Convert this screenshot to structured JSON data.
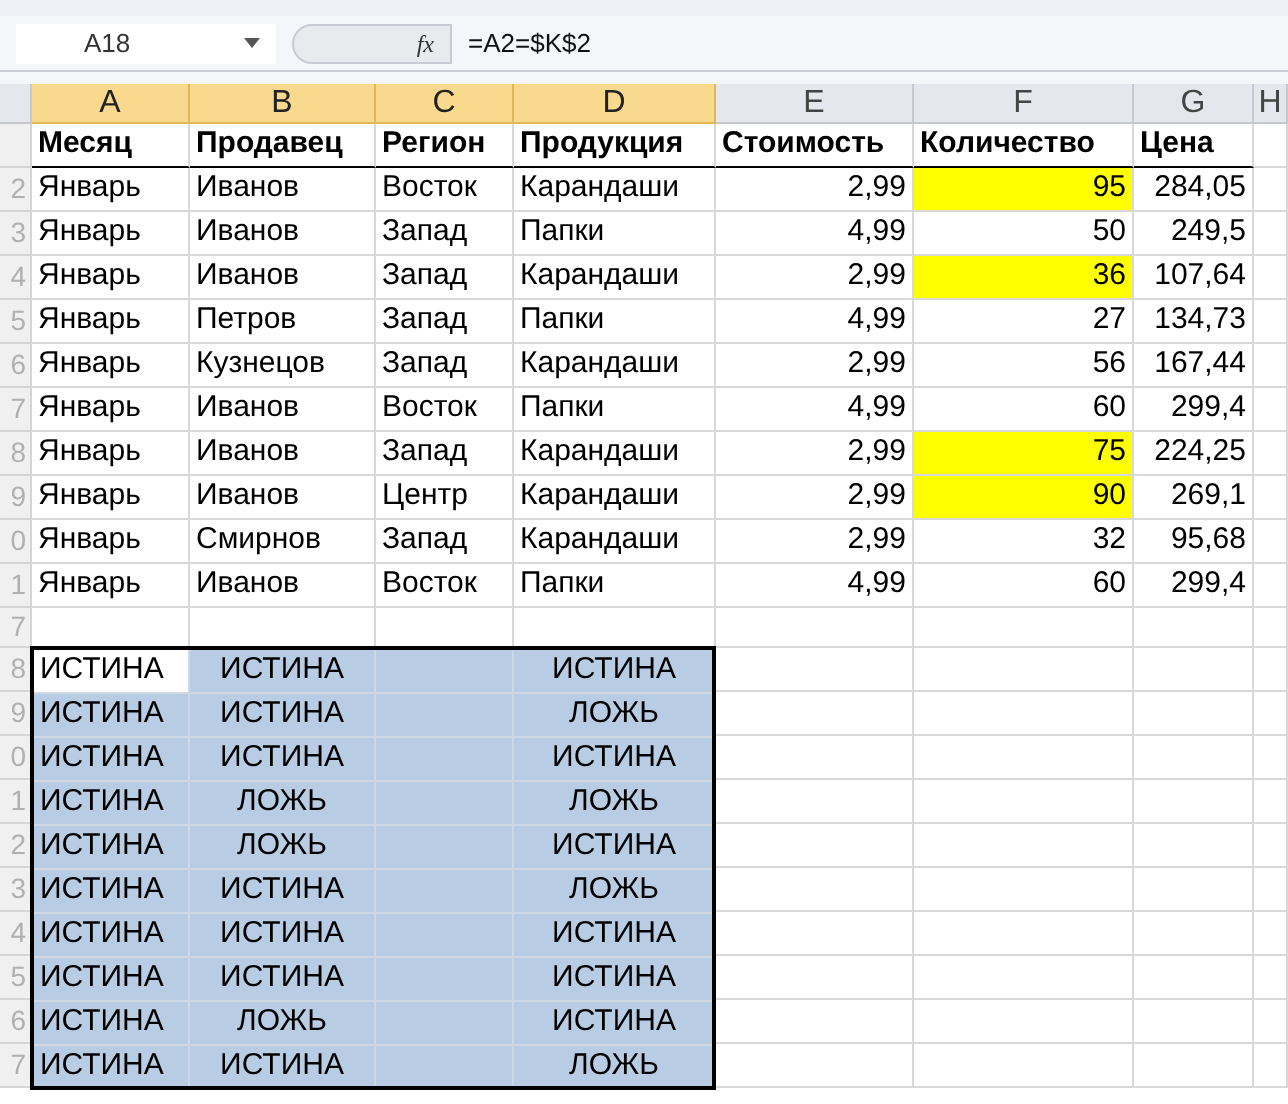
{
  "formula_bar": {
    "name_box": "A18",
    "fx": "fx",
    "formula": "=A2=$K$2"
  },
  "columns": [
    {
      "label": "A",
      "selected": true
    },
    {
      "label": "B",
      "selected": true
    },
    {
      "label": "C",
      "selected": true
    },
    {
      "label": "D",
      "selected": true
    },
    {
      "label": "E",
      "selected": false
    },
    {
      "label": "F",
      "selected": false
    },
    {
      "label": "G",
      "selected": false
    },
    {
      "label": "H",
      "selected": false
    }
  ],
  "header_row": {
    "cells": [
      "Месяц",
      "Продавец",
      "Регион",
      "Продукция",
      "Стоимость",
      "Количество",
      "Цена"
    ]
  },
  "rows": [
    {
      "row_number": "2",
      "cells": [
        "Январь",
        "Иванов",
        "Восток",
        "Карандаши",
        "2,99",
        "95",
        "284,05"
      ],
      "highlighted": true
    },
    {
      "row_number": "3",
      "cells": [
        "Январь",
        "Иванов",
        "Запад",
        "Папки",
        "4,99",
        "50",
        "249,5"
      ],
      "highlighted": false
    },
    {
      "row_number": "4",
      "cells": [
        "Январь",
        "Иванов",
        "Запад",
        "Карандаши",
        "2,99",
        "36",
        "107,64"
      ],
      "highlighted": true
    },
    {
      "row_number": "5",
      "cells": [
        "Январь",
        "Петров",
        "Запад",
        "Папки",
        "4,99",
        "27",
        "134,73"
      ],
      "highlighted": false
    },
    {
      "row_number": "6",
      "cells": [
        "Январь",
        "Кузнецов",
        "Запад",
        "Карандаши",
        "2,99",
        "56",
        "167,44"
      ],
      "highlighted": false
    },
    {
      "row_number": "7",
      "cells": [
        "Январь",
        "Иванов",
        "Восток",
        "Папки",
        "4,99",
        "60",
        "299,4"
      ],
      "highlighted": false
    },
    {
      "row_number": "8",
      "cells": [
        "Январь",
        "Иванов",
        "Запад",
        "Карандаши",
        "2,99",
        "75",
        "224,25"
      ],
      "highlighted": true
    },
    {
      "row_number": "9",
      "cells": [
        "Январь",
        "Иванов",
        "Центр",
        "Карандаши",
        "2,99",
        "90",
        "269,1"
      ],
      "highlighted": true
    },
    {
      "row_number": "0",
      "cells": [
        "Январь",
        "Смирнов",
        "Запад",
        "Карандаши",
        "2,99",
        "32",
        "95,68"
      ],
      "highlighted": false
    },
    {
      "row_number": "1",
      "cells": [
        "Январь",
        "Иванов",
        "Восток",
        "Папки",
        "4,99",
        "60",
        "299,4"
      ],
      "highlighted": false
    }
  ],
  "gap_row": {
    "row_number": "7"
  },
  "result_rows": [
    {
      "row_number": "8",
      "a": "ИСТИНА",
      "b": "ИСТИНА",
      "d": "ИСТИНА",
      "active": true
    },
    {
      "row_number": "9",
      "a": "ИСТИНА",
      "b": "ИСТИНА",
      "d": "ЛОЖЬ",
      "active": false
    },
    {
      "row_number": "0",
      "a": "ИСТИНА",
      "b": "ИСТИНА",
      "d": "ИСТИНА",
      "active": false
    },
    {
      "row_number": "1",
      "a": "ИСТИНА",
      "b": "ЛОЖЬ",
      "d": "ЛОЖЬ",
      "active": false
    },
    {
      "row_number": "2",
      "a": "ИСТИНА",
      "b": "ЛОЖЬ",
      "d": "ИСТИНА",
      "active": false
    },
    {
      "row_number": "3",
      "a": "ИСТИНА",
      "b": "ИСТИНА",
      "d": "ЛОЖЬ",
      "active": false
    },
    {
      "row_number": "4",
      "a": "ИСТИНА",
      "b": "ИСТИНА",
      "d": "ИСТИНА",
      "active": false
    },
    {
      "row_number": "5",
      "a": "ИСТИНА",
      "b": "ИСТИНА",
      "d": "ИСТИНА",
      "active": false
    },
    {
      "row_number": "6",
      "a": "ИСТИНА",
      "b": "ЛОЖЬ",
      "d": "ИСТИНА",
      "active": false
    },
    {
      "row_number": "7",
      "a": "ИСТИНА",
      "b": "ИСТИНА",
      "d": "ЛОЖЬ",
      "active": false
    }
  ]
}
